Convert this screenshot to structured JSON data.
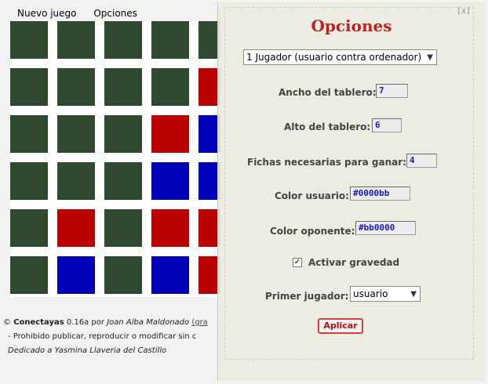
{
  "menu": {
    "new_game": "Nuevo juego",
    "options": "Opciones"
  },
  "colors": {
    "user": "#0000bb",
    "opponent": "#bb0000",
    "empty_cell": "#2f4a2f",
    "title": "#bb2222"
  },
  "board": {
    "rows": [
      [
        "e",
        "e",
        "e",
        "e",
        "e"
      ],
      [
        "e",
        "e",
        "e",
        "e",
        "r"
      ],
      [
        "e",
        "e",
        "e",
        "r",
        "b"
      ],
      [
        "e",
        "e",
        "e",
        "b",
        "b"
      ],
      [
        "e",
        "r",
        "e",
        "r",
        "r"
      ],
      [
        "e",
        "b",
        "e",
        "b",
        "r"
      ]
    ]
  },
  "footer": {
    "copyright": "©",
    "app_name": "Conectayas",
    "version": "0.16a por",
    "author": "Joan Alba Maldonado",
    "link_fragment": "(gra",
    "notice": "- Prohibido publicar, reproducir o modificar sin c",
    "dedication": "Dedicado a Yasmina Llaveria del Castillo"
  },
  "options": {
    "close_label": "[x]",
    "title": "Opciones",
    "mode": "1 Jugador (usuario contra ordenador)",
    "board_width_label": "Ancho del tablero:",
    "board_width": "7",
    "board_height_label": "Alto del tablero:",
    "board_height": "6",
    "win_count_label": "Fichas necesarias para ganar:",
    "win_count": "4",
    "user_color_label": "Color usuario:",
    "user_color": "#0000bb",
    "opponent_color_label": "Color oponente:",
    "opponent_color": "#bb0000",
    "gravity_label": "Activar gravedad",
    "gravity_checked": "✓",
    "first_player_label": "Primer jugador:",
    "first_player": "usuario",
    "apply_label": "Aplicar"
  }
}
